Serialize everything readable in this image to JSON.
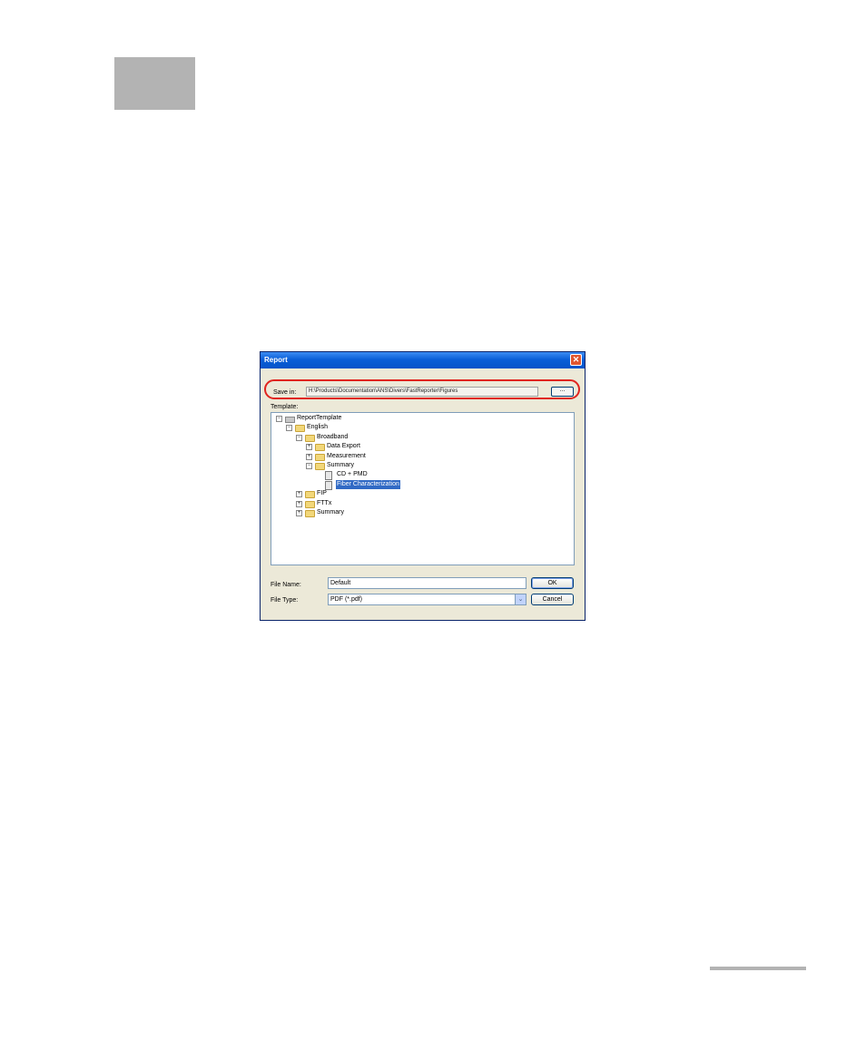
{
  "dialog": {
    "title": "Report",
    "close_glyph": "✕",
    "save_in": {
      "label": "Save in:",
      "path": "H:\\Products\\Documentation\\ANS\\Divers\\FastReporter\\Figures",
      "browse_label": "..."
    },
    "template": {
      "label": "Template:",
      "tree": [
        {
          "label": "ReportTemplate",
          "toggle": "−",
          "icon": "root",
          "depth": 0
        },
        {
          "label": "English",
          "toggle": "−",
          "icon": "folder",
          "depth": 1
        },
        {
          "label": "Broadband",
          "toggle": "−",
          "icon": "folder",
          "depth": 2
        },
        {
          "label": "Data Export",
          "toggle": "+",
          "icon": "folder",
          "depth": 3
        },
        {
          "label": "Measurement",
          "toggle": "+",
          "icon": "folder",
          "depth": 3
        },
        {
          "label": "Summary",
          "toggle": "−",
          "icon": "folder",
          "depth": 3
        },
        {
          "label": "CD + PMD",
          "toggle": "",
          "icon": "document",
          "depth": 4
        },
        {
          "label": "Fiber Characterization",
          "toggle": "",
          "icon": "document",
          "depth": 4,
          "selected": true
        },
        {
          "label": "FIP",
          "toggle": "+",
          "icon": "folder",
          "depth": 2
        },
        {
          "label": "FTTx",
          "toggle": "+",
          "icon": "folder",
          "depth": 2
        },
        {
          "label": "Summary",
          "toggle": "+",
          "icon": "folder",
          "depth": 2
        }
      ]
    },
    "file_name": {
      "label": "File Name:",
      "value": "Default"
    },
    "file_type": {
      "label": "File Type:",
      "value": "PDF (*.pdf)",
      "dropdown_glyph": "⌄"
    },
    "buttons": {
      "ok": "OK",
      "cancel": "Cancel"
    }
  },
  "colors": {
    "dialog_bg": "#ece9d8",
    "titlebar": "#0a5fd8",
    "highlight_circle": "#e0241f",
    "selection": "#316ac5",
    "page_block": "#b3b3b3"
  }
}
